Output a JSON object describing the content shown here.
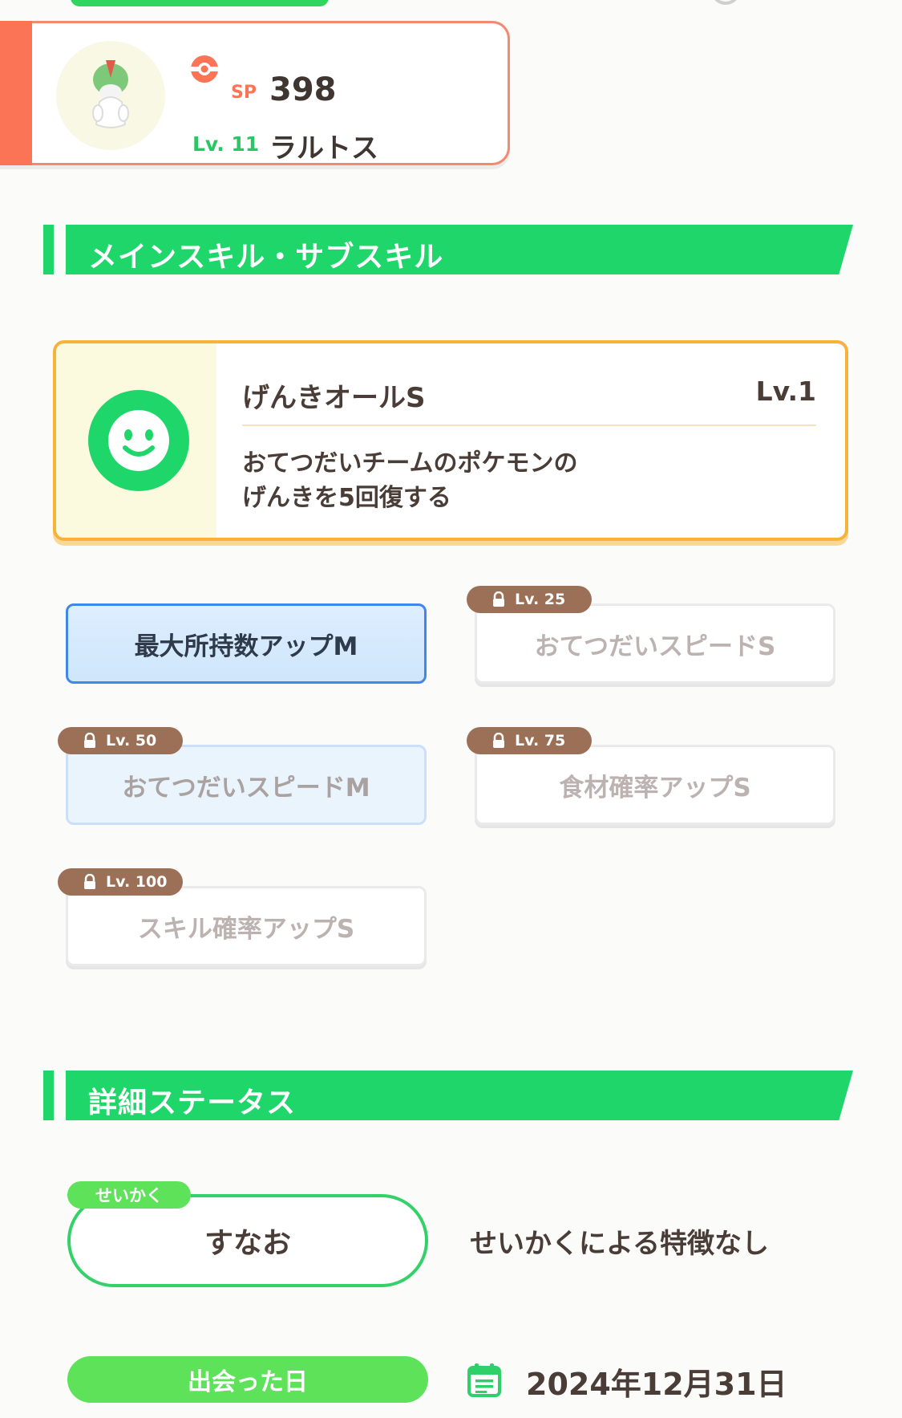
{
  "pokemon": {
    "sp_label": "SP",
    "sp_value": "398",
    "level_label": "Lv. 11",
    "name": "ラルトス",
    "accent_color": "#fb7455"
  },
  "sections": {
    "skills_title": "メインスキル・サブスキル",
    "details_title": "詳細ステータス"
  },
  "main_skill": {
    "name": "げんきオールS",
    "level": "Lv.1",
    "description_line1": "おてつだいチームのポケモンの",
    "description_line2": "げんきを5回復する",
    "icon": "smiley-face-icon"
  },
  "sub_skills": [
    {
      "name": "最大所持数アップM",
      "locked": false
    },
    {
      "name": "おてつだいスピードS",
      "unlock_level": "Lv. 25",
      "locked": true
    },
    {
      "name": "おてつだいスピードM",
      "unlock_level": "Lv. 50",
      "locked": true
    },
    {
      "name": "食材確率アップS",
      "unlock_level": "Lv. 75",
      "locked": true
    },
    {
      "name": "スキル確率アップS",
      "unlock_level": "Lv. 100",
      "locked": true
    }
  ],
  "details": {
    "nature_tag": "せいかく",
    "nature_value": "すなお",
    "nature_effect": "せいかくによる特徴なし",
    "met_label": "出会った日",
    "met_date": "2024年12月31日"
  },
  "colors": {
    "section_green": "#1fd66b",
    "main_skill_border": "#f7b23a",
    "lock_badge": "#9b7056"
  }
}
